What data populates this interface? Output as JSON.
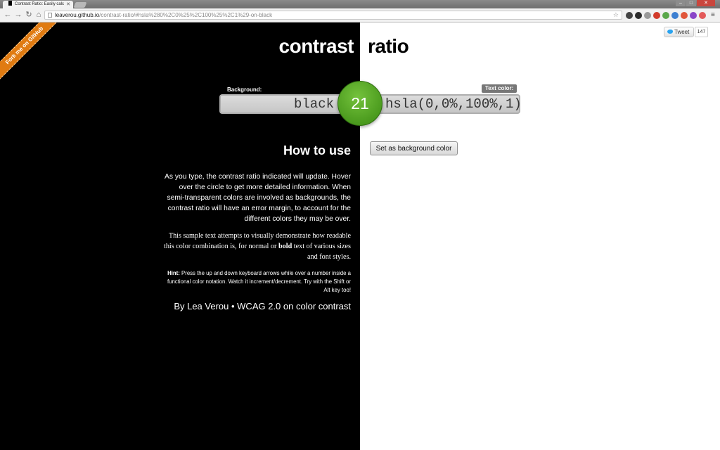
{
  "browser": {
    "tab_title": "Contrast Ratio: Easily calc",
    "faint_tab_text": "",
    "url_host": "leaverou.github.io",
    "url_path": "/contrast-ratio/#hsla%280%2C0%25%2C100%25%2C1%29-on-black",
    "extension_icons": [
      {
        "name": "cursor-extension-icon",
        "color": "#444444"
      },
      {
        "name": "globe-extension-icon",
        "color": "#2c2c2c"
      },
      {
        "name": "speaker-extension-icon",
        "color": "#9a9a9a"
      },
      {
        "name": "stop-extension-icon",
        "color": "#d23b2b"
      },
      {
        "name": "evernote-extension-icon",
        "color": "#5aa84a"
      },
      {
        "name": "mail-extension-icon",
        "color": "#3d7fd1"
      },
      {
        "name": "colorzilla-extension-icon",
        "color": "#e0563a"
      },
      {
        "name": "color-grid-extension-icon",
        "color": "#8a46c8"
      },
      {
        "name": "recorder-extension-icon",
        "color": "#e35a5a"
      }
    ]
  },
  "page": {
    "ribbon_text": "Fork me on GitHub",
    "title_left": "contrast",
    "title_right": "ratio",
    "tweet_label": "Tweet",
    "tweet_count": "147",
    "background_label": "Background:",
    "background_value": "black",
    "text_color_label": "Text color:",
    "text_color_value": "hsla(0,0%,100%,1)",
    "ratio": "21",
    "ratio_color": "#5aa829",
    "set_bg_button": "Set as background color",
    "howto_heading": "How to use",
    "para1": "As you type, the contrast ratio indicated will update. Hover over the circle to get more detailed information. When semi-transparent colors are involved as backgrounds, the contrast ratio will have an error margin, to account for the different colors they may be over.",
    "para2_before": "This sample text attempts to visually demonstrate how readable this color combination is, for normal or ",
    "para2_bold": "bold",
    "para2_after": " text of various sizes and font styles.",
    "hint_label": "Hint:",
    "hint_text": " Press the up and down keyboard arrows while over a number inside a functional color notation. Watch it increment/decrement. Try with the Shift or Alt key too!",
    "byline_author": "By Lea Verou",
    "byline_sep": " • ",
    "byline_link": "WCAG 2.0 on color contrast"
  }
}
